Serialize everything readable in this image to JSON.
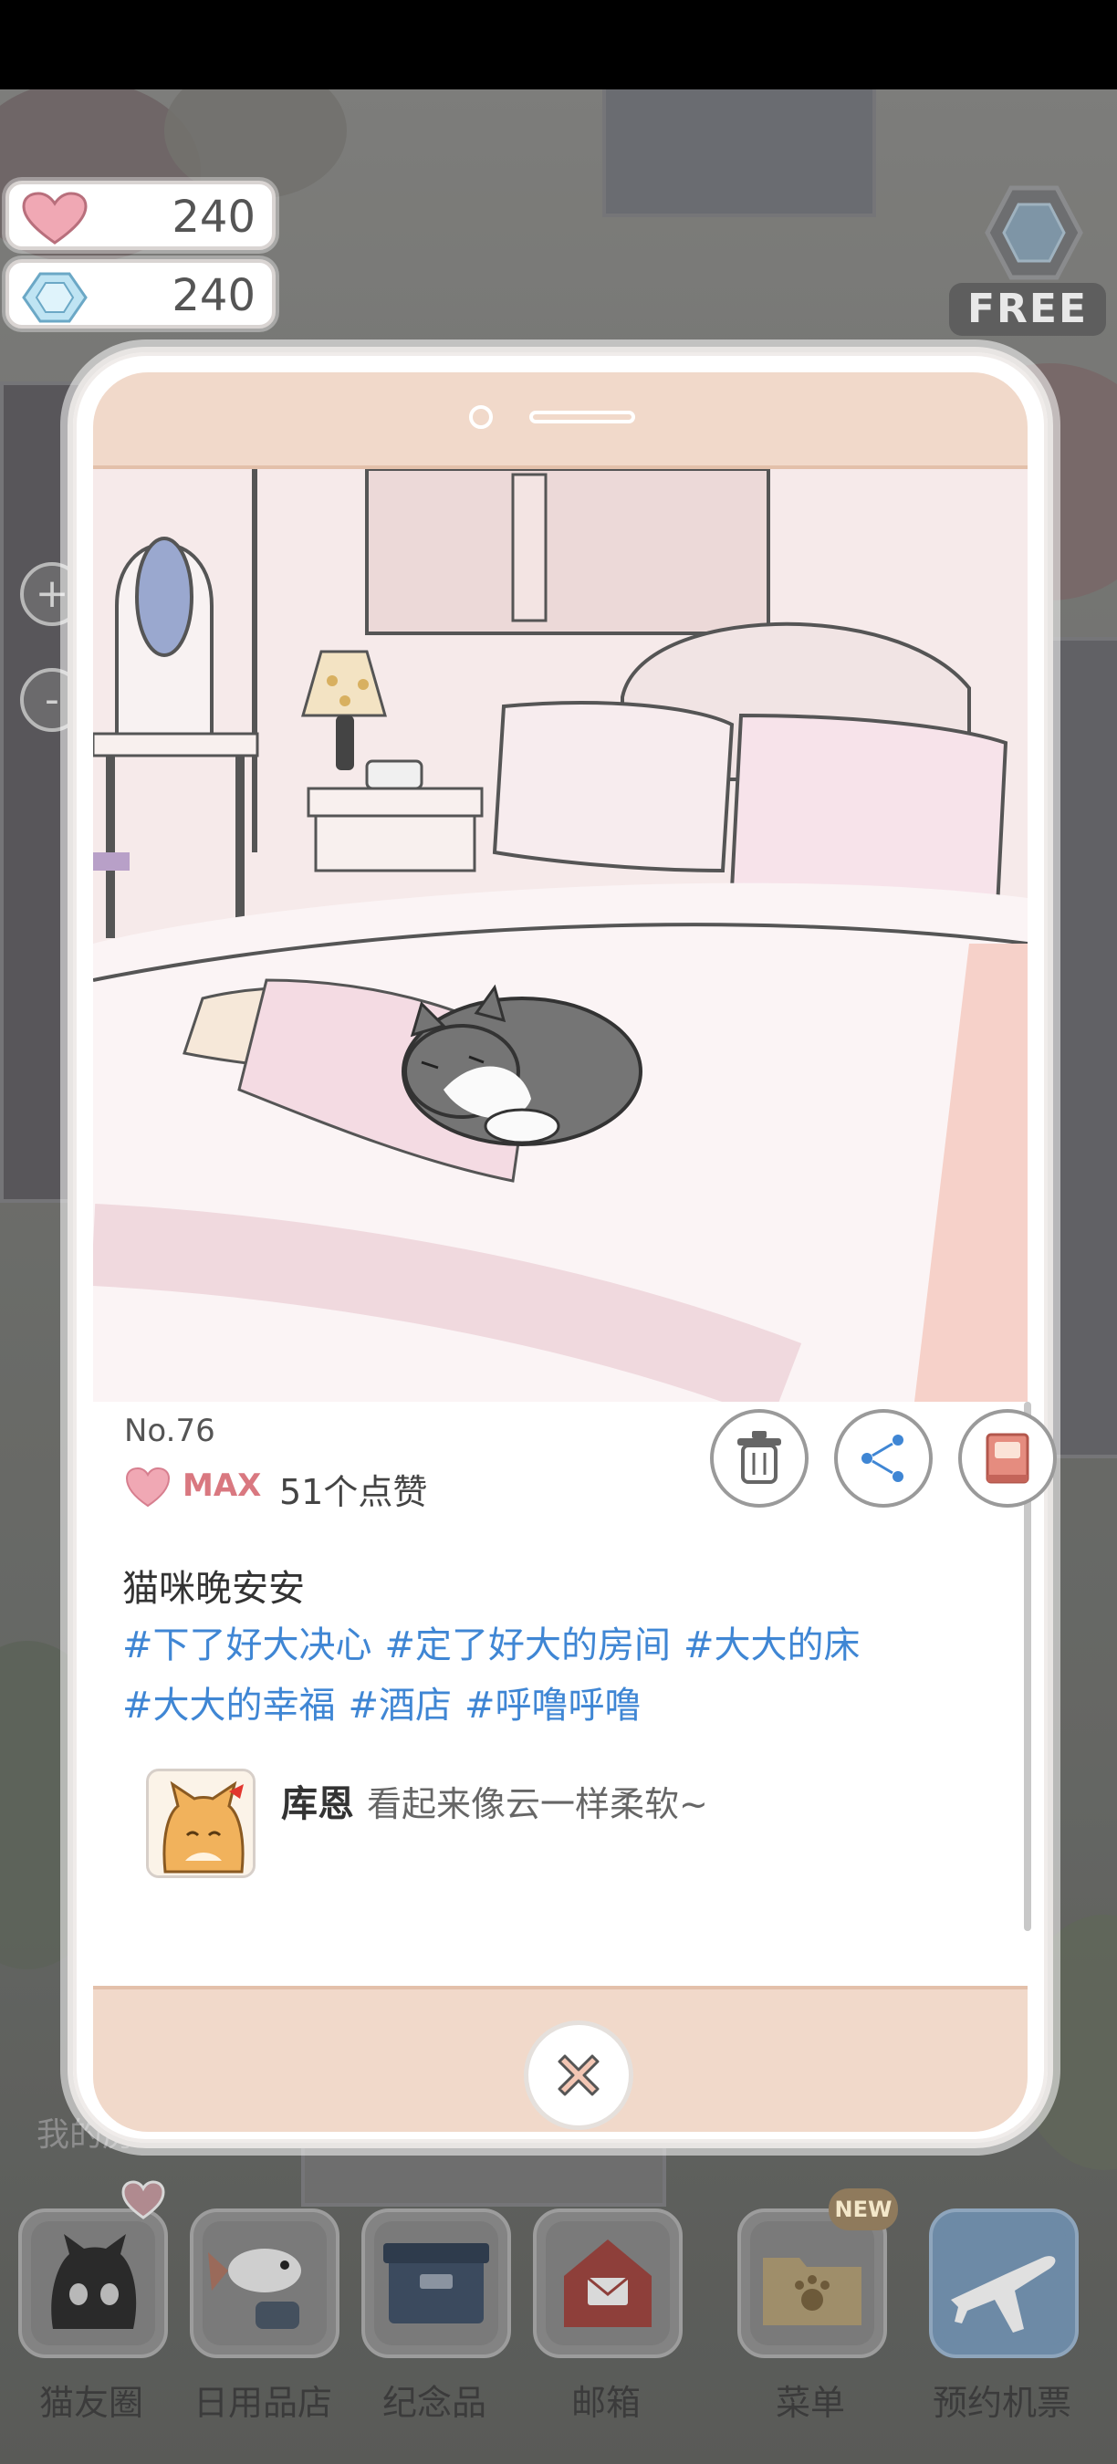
{
  "currency": {
    "hearts": "240",
    "gems": "240"
  },
  "free_button": {
    "label": "FREE"
  },
  "zoom": {
    "in_label": "+",
    "out_label": "-"
  },
  "my_room_label": "我的房",
  "post": {
    "number": "No.76",
    "level": "MAX",
    "likes": "51个点赞",
    "caption": "猫咪晚安安",
    "tags": [
      "#下了好大决心",
      "#定了好大的房间",
      "#大大的床",
      "#大大的幸福",
      "#酒店",
      "#呼噜呼噜"
    ],
    "comment": {
      "author": "库恩",
      "text": "看起来像云一样柔软~"
    }
  },
  "nav": {
    "items": [
      {
        "label": "猫友圈",
        "icon": "cat-face-icon"
      },
      {
        "label": "日用品店",
        "icon": "koi-fish-icon"
      },
      {
        "label": "纪念品",
        "icon": "box-icon"
      },
      {
        "label": "邮箱",
        "icon": "mailbox-icon"
      },
      {
        "label": "菜单",
        "icon": "folder-icon",
        "badge": "NEW"
      },
      {
        "label": "预约机票",
        "icon": "airplane-icon"
      }
    ]
  },
  "colors": {
    "heart": "#f0a8b4",
    "tag_blue": "#3f86d4",
    "phone_frame_pink": "#f1d9ca",
    "max_red": "#d97880"
  }
}
